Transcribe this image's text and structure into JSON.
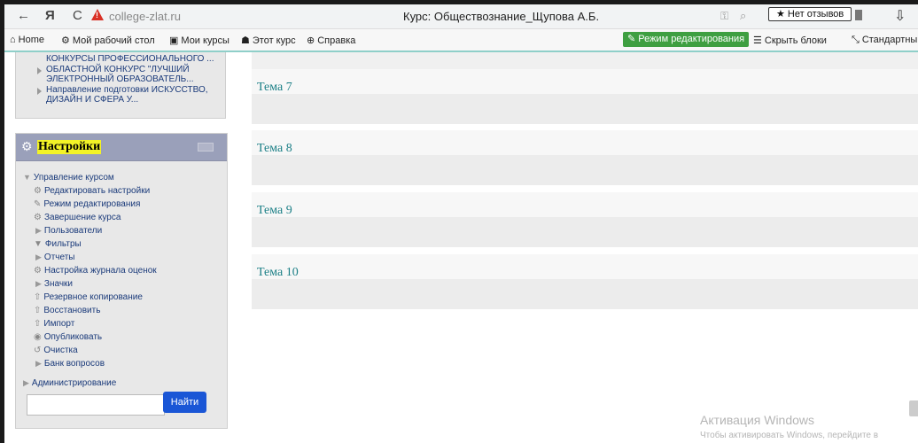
{
  "browser": {
    "back_icon": "←",
    "ya_icon": "Я",
    "reload_icon": "C",
    "url": "college-zlat.ru",
    "title": "Курс: Обществознание_Щупова А.Б.",
    "review_label": "★ Нет отзывов"
  },
  "nav": {
    "home": "Home",
    "dashboard": "Мой рабочий стол",
    "my_courses": "Мои курсы",
    "this_course": "Этот курс",
    "help": "Справка",
    "edit_mode": "Режим редактирования",
    "hide_blocks": "Скрыть блоки",
    "standard_view": "Стандартный вид"
  },
  "block_courses": {
    "items": [
      "КОНКУРСЫ ПРОФЕССИОНАЛЬНОГО ...",
      "ОБЛАСТНОЙ КОНКУРС \"ЛУЧШИЙ ЭЛЕКТРОННЫЙ ОБРАЗОВАТЕЛЬ...",
      "Направление подготовки ИСКУССТВО, ДИЗАЙН И СФЕРА У..."
    ]
  },
  "settings": {
    "title": "Настройки",
    "course_admin": "Управление курсом",
    "items": [
      {
        "label": "Редактировать настройки",
        "icon": "gear-icon"
      },
      {
        "label": "Режим редактирования",
        "icon": "pencil-icon"
      },
      {
        "label": "Завершение курса",
        "icon": "gear-icon"
      },
      {
        "label": "Пользователи",
        "icon": "expand-icon"
      },
      {
        "label": "Фильтры",
        "icon": "filter-icon"
      },
      {
        "label": "Отчеты",
        "icon": "expand-icon"
      },
      {
        "label": "Настройка журнала оценок",
        "icon": "gear-icon"
      },
      {
        "label": "Значки",
        "icon": "expand-icon"
      },
      {
        "label": "Резервное копирование",
        "icon": "upload-icon"
      },
      {
        "label": "Восстановить",
        "icon": "upload-icon"
      },
      {
        "label": "Импорт",
        "icon": "upload-icon"
      },
      {
        "label": "Опубликовать",
        "icon": "publish-icon"
      },
      {
        "label": "Очистка",
        "icon": "reset-icon"
      },
      {
        "label": "Банк вопросов",
        "icon": "expand-icon"
      }
    ],
    "site_admin": "Администрирование",
    "search_button": "Найти",
    "search_value": ""
  },
  "topics": [
    "Тема 7",
    "Тема 8",
    "Тема 9",
    "Тема 10"
  ],
  "windows": {
    "activation_title": "Активация Windows",
    "activation_sub": "Чтобы активировать Windows, перейдите в"
  }
}
